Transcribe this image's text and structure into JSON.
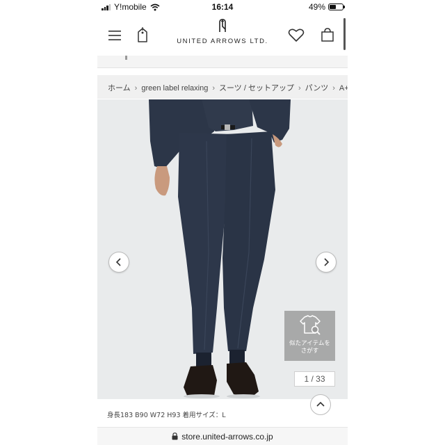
{
  "status_bar": {
    "carrier": "Y!mobile",
    "time": "16:14",
    "battery_percent": "49%",
    "battery_level": 0.49,
    "icons": [
      "signal-icon",
      "wifi-icon",
      "battery-icon"
    ]
  },
  "header": {
    "logo_text": "UNITED ARROWS LTD.",
    "icons": [
      "menu-icon",
      "tag-icon",
      "heart-icon",
      "shopping-bag-icon"
    ]
  },
  "breadcrumb": [
    "ホーム",
    "green label relaxing",
    "スーツ / セットアップ",
    "パンツ",
    "A+ TWP"
  ],
  "gallery": {
    "similar_items_label": "似たアイテムをさがす",
    "current_page": 1,
    "total_pages": 33,
    "page_counter": "1 / 33",
    "icons": [
      "chevron-left-icon",
      "chevron-right-icon",
      "tshirt-search-icon"
    ]
  },
  "caption": "身長183 B90 W72 H93 着用サイズ：L",
  "browser": {
    "url": "store.united-arrows.co.jp",
    "icons": [
      "lock-icon",
      "chevron-up-icon"
    ]
  },
  "colors": {
    "suit": "#2b3547",
    "background": "#e9ebec",
    "breadcrumb_bg": "#f0f0f0"
  }
}
